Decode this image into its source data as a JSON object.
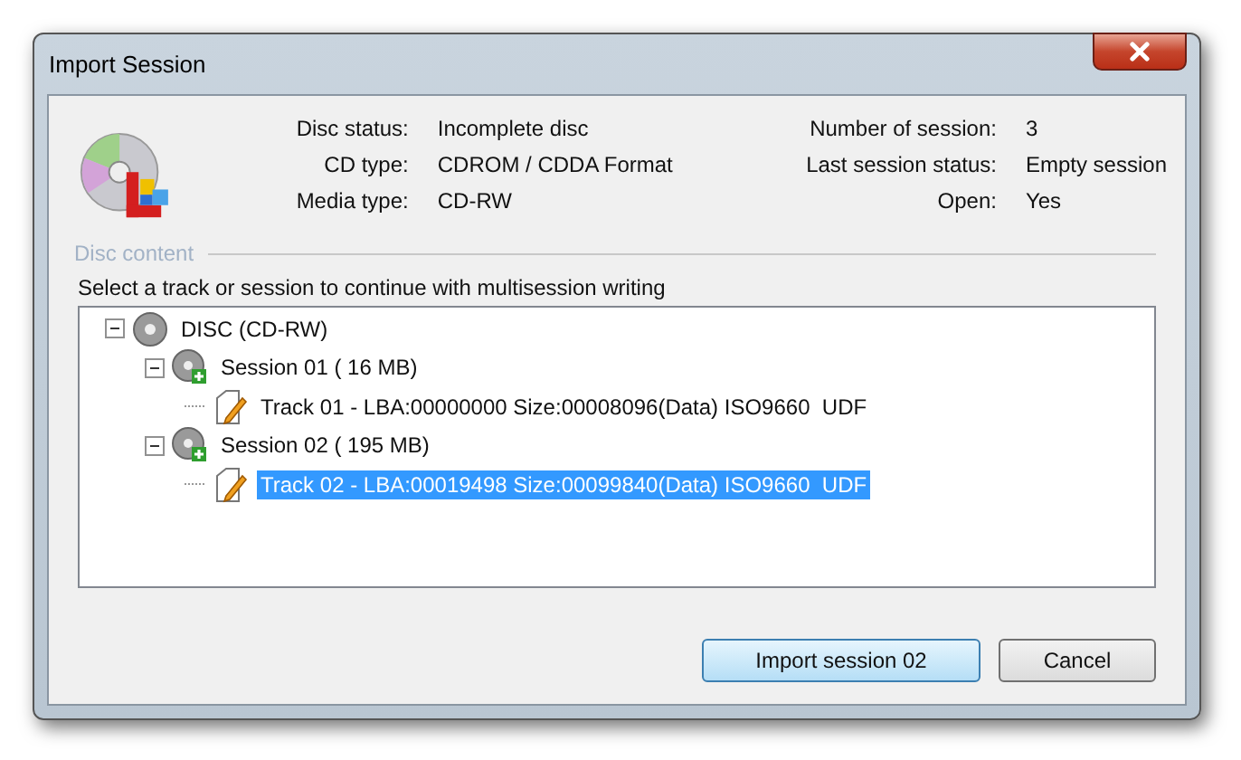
{
  "window": {
    "title": "Import Session"
  },
  "info_left": [
    {
      "label": "Disc status:",
      "value": "Incomplete disc"
    },
    {
      "label": "CD type:",
      "value": "CDROM / CDDA Format"
    },
    {
      "label": "Media type:",
      "value": "CD-RW"
    }
  ],
  "info_right": [
    {
      "label": "Number of session:",
      "value": "3"
    },
    {
      "label": "Last session status:",
      "value": "Empty session"
    },
    {
      "label": "Open:",
      "value": "Yes"
    }
  ],
  "group_title": "Disc content",
  "instruction": "Select a track or session to continue with multisession writing",
  "tree": [
    {
      "kind": "disc",
      "label": "DISC (CD-RW)",
      "expanded": true,
      "selected": false,
      "children": [
        {
          "kind": "session",
          "label": "Session 01 ( 16 MB)",
          "expanded": true,
          "selected": false,
          "children": [
            {
              "kind": "track",
              "label": "Track 01 - LBA:00000000 Size:00008096(Data) ISO9660  UDF",
              "selected": false
            }
          ]
        },
        {
          "kind": "session",
          "label": "Session 02 ( 195 MB)",
          "expanded": true,
          "selected": false,
          "children": [
            {
              "kind": "track",
              "label": "Track 02 - LBA:00019498 Size:00099840(Data) ISO9660  UDF",
              "selected": true
            }
          ]
        }
      ]
    }
  ],
  "buttons": [
    {
      "label": "Import session 02",
      "default": true
    },
    {
      "label": "Cancel",
      "default": false
    }
  ]
}
